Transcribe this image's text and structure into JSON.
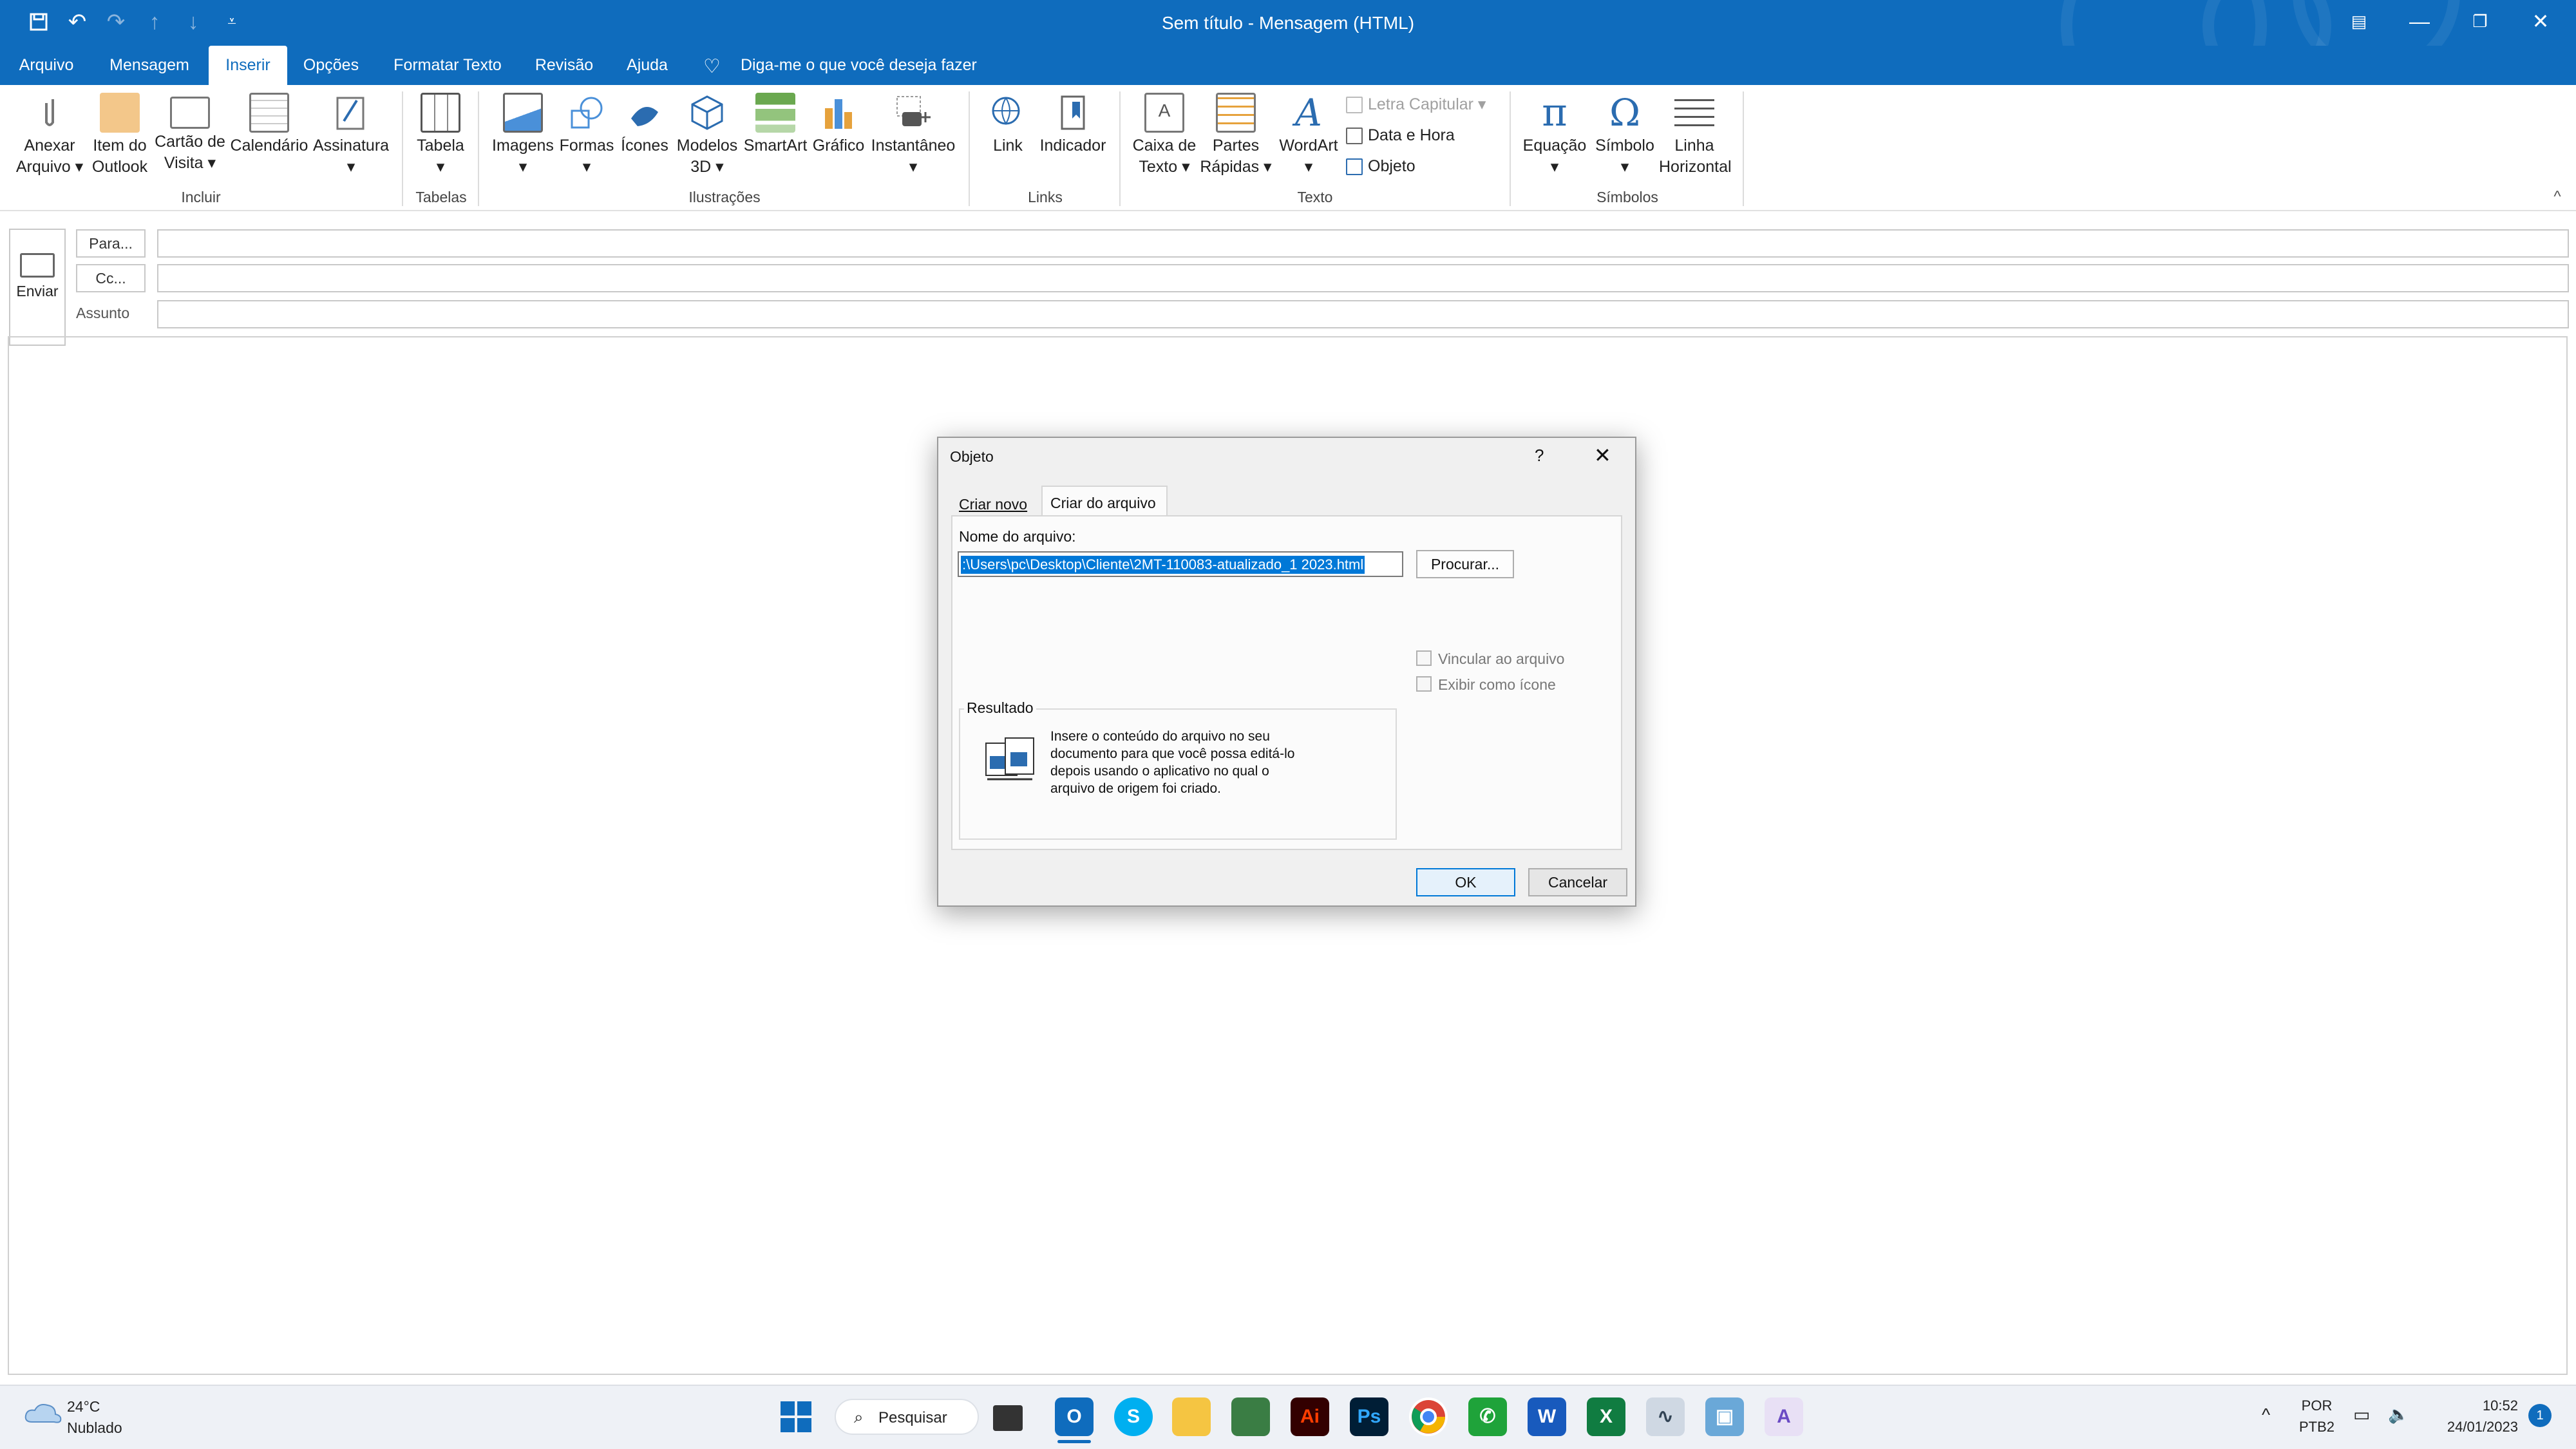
{
  "window": {
    "title": "Sem título  -  Mensagem (HTML)"
  },
  "ribbon_tabs": [
    "Arquivo",
    "Mensagem",
    "Inserir",
    "Opções",
    "Formatar Texto",
    "Revisão",
    "Ajuda"
  ],
  "tell_me": "Diga-me o que você deseja fazer",
  "ribbon": {
    "buttons": {
      "anexar": [
        "Anexar",
        "Arquivo"
      ],
      "item_outlook": [
        "Item do",
        "Outlook"
      ],
      "cartao": [
        "Cartão de",
        "Visita"
      ],
      "calendario": "Calendário",
      "assinatura": "Assinatura",
      "tabela": "Tabela",
      "imagens": "Imagens",
      "formas": "Formas",
      "icones": "Ícones",
      "modelos": [
        "Modelos",
        "3D"
      ],
      "smartart": "SmartArt",
      "grafico": "Gráfico",
      "instantaneo": "Instantâneo",
      "link": "Link",
      "indicador": "Indicador",
      "caixa_texto": [
        "Caixa de",
        "Texto"
      ],
      "partes": [
        "Partes",
        "Rápidas"
      ],
      "wordart": "WordArt",
      "letra_capitular": "Letra Capitular",
      "data_hora": "Data e Hora",
      "objeto": "Objeto",
      "equacao": "Equação",
      "simbolo": "Símbolo",
      "linha": [
        "Linha",
        "Horizontal"
      ]
    },
    "groups": [
      "Incluir",
      "Tabelas",
      "Ilustrações",
      "Links",
      "Texto",
      "Símbolos"
    ]
  },
  "compose": {
    "send": "Enviar",
    "to": "Para...",
    "cc": "Cc...",
    "subject": "Assunto"
  },
  "dialog": {
    "title": "Objeto",
    "help": "?",
    "tabs": [
      "Criar novo",
      "Criar do arquivo"
    ],
    "filename_label": "Nome do arquivo:",
    "filename_value": ":\\Users\\pc\\Desktop\\Cliente\\2MT-110083-atualizado_1 2023.html",
    "browse": "Procurar...",
    "link_file": "Vincular ao arquivo",
    "show_icon": "Exibir como ícone",
    "result_label": "Resultado",
    "result_text": [
      "Insere o conteúdo do arquivo no seu",
      "documento para que você possa editá-lo",
      "depois usando o aplicativo no qual o",
      "arquivo de origem foi criado."
    ],
    "ok": "OK",
    "cancel": "Cancelar"
  },
  "taskbar": {
    "weather_temp": "24°C",
    "weather_desc": "Nublado",
    "search": "Pesquisar",
    "lang1": "POR",
    "lang2": "PTB2",
    "time": "10:52",
    "date": "24/01/2023",
    "notifications": "1"
  },
  "colors": {
    "accent": "#0f6cbd",
    "selection": "#0078d7"
  }
}
